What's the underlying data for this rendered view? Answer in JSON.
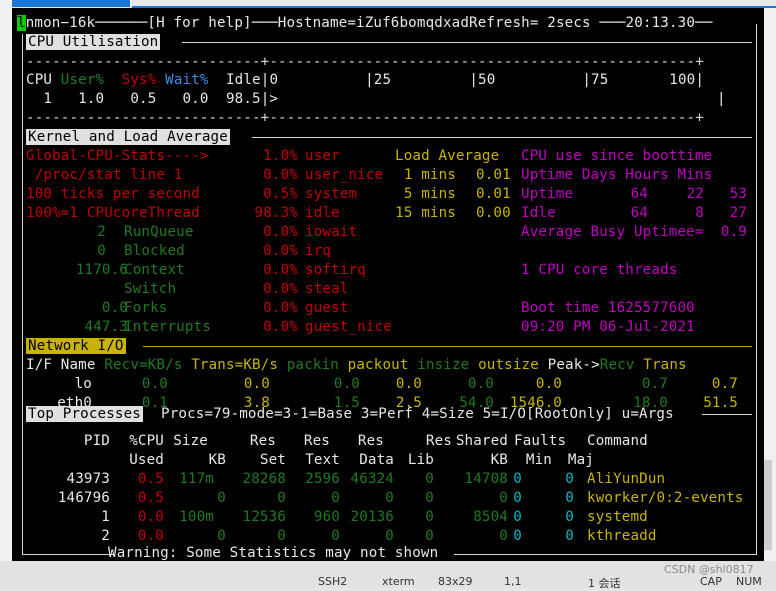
{
  "window": {
    "status_bar": {
      "ssh": "SSH2",
      "term": "xterm",
      "size": "83x29",
      "pos": "1,1",
      "sessions": "1 会话",
      "caps": "CAP",
      "num": "NUM"
    },
    "watermark": "CSDN @shl0817"
  },
  "header": {
    "cursor_char": "l",
    "app": "nmon−16k",
    "help": "[H for help]",
    "hostname_label": "Hostname=",
    "hostname": "iZuf6bomqdxad",
    "refresh_label": "Refresh=",
    "refresh": " 2secs",
    "time": "20:13.30"
  },
  "cpu_util": {
    "title": "CPU Utilisation",
    "dash_top": "---------------------------+-------------------------------------------------+",
    "col_cpu": "CPU",
    "col_user": "User%",
    "col_sys": "Sys%",
    "col_wait": "Wait%",
    "col_idle": "Idle",
    "scale": "|0          |25         |50          |75       100|",
    "row": {
      "cpu": "1",
      "user": "1.0",
      "sys": "0.5",
      "wait": "0.0",
      "idle": "98.5",
      "bar": "|>"
    },
    "bar_end": "|",
    "dash_bottom": "---------------------------+-------------------------------------------------+"
  },
  "kernel": {
    "title": "Kernel and Load Average",
    "left_labels": [
      "Global-CPU-Stats---->",
      " /proc/stat line 1",
      "100 ticks per second",
      "100%=1 CPUcoreThread"
    ],
    "counters": [
      {
        "value": "2",
        "label": "RunQueue"
      },
      {
        "value": "0",
        "label": "Blocked"
      },
      {
        "value": "1170.6",
        "label": "Context"
      },
      {
        "value": "",
        "label": "Switch"
      },
      {
        "value": "0.0",
        "label": "Forks"
      },
      {
        "value": "447.3",
        "label": "Interrupts"
      }
    ],
    "cpu_stats": [
      {
        "pct": "1.0%",
        "name": "user"
      },
      {
        "pct": "0.0%",
        "name": "user_nice"
      },
      {
        "pct": "0.5%",
        "name": "system"
      },
      {
        "pct": "98.3%",
        "name": "idle"
      },
      {
        "pct": "0.0%",
        "name": "iowait"
      },
      {
        "pct": "0.0%",
        "name": "irq"
      },
      {
        "pct": "0.0%",
        "name": "softirq"
      },
      {
        "pct": "0.0%",
        "name": "steal"
      },
      {
        "pct": "0.0%",
        "name": "guest"
      },
      {
        "pct": "0.0%",
        "name": "guest_nice"
      }
    ],
    "load_title": "Load Average",
    "load": [
      {
        "period": "1 mins",
        "value": "0.01"
      },
      {
        "period": "5 mins",
        "value": "0.01"
      },
      {
        "period": "15 mins",
        "value": "0.00"
      }
    ],
    "boot_title": "CPU use since boottime",
    "uptime_header": "Uptime Days Hours Mins",
    "uptime": {
      "label": "Uptime",
      "days": "64",
      "hours": "22",
      "mins": "53"
    },
    "idle": {
      "label": "Idle",
      "days": "64",
      "hours": "8",
      "mins": "27"
    },
    "avg_busy": "Average Busy Uptimee=  0.9",
    "cores": "1 CPU core threads",
    "boot_time": "Boot time 1625577600",
    "boot_date": "09:20 PM 06-Jul-2021"
  },
  "network": {
    "title": "Network I/O",
    "headers": {
      "ifname": "I/F Name",
      "recv": "Recv=KB/s",
      "trans": "Trans=KB/s",
      "packin": "packin",
      "packout": "packout",
      "insize": "insize",
      "outsize": "outsize",
      "peak": "Peak->",
      "peak_recv": "Recv",
      "peak_trans": "Trans"
    },
    "rows": [
      {
        "name": "lo",
        "recv": "0.0",
        "trans": "0.0",
        "packin": "0.0",
        "packout": "0.0",
        "insize": "0.0",
        "outsize": "0.0",
        "peak_recv": "0.7",
        "peak_trans": "0.7"
      },
      {
        "name": "eth0",
        "recv": "0.1",
        "trans": "3.8",
        "packin": "1.5",
        "packout": "2.5",
        "insize": "54.0",
        "outsize": "1546.0",
        "peak_recv": "18.0",
        "peak_trans": "51.5"
      }
    ]
  },
  "processes": {
    "title": "Top Processes",
    "mode_info": "Procs=79-mode=3-1=Base 3=Perf 4=Size 5=I/O[RootOnly] u=Args",
    "header1": {
      "pid": "PID",
      "cpu": "%CPU",
      "size": "Size",
      "res_set": "Res",
      "res_text": "Res",
      "res_data": "Res",
      "res_lib": "Res",
      "shared": "Shared",
      "faults": "Faults",
      "command": "Command"
    },
    "header2": {
      "cpu": "Used",
      "size": "KB",
      "res_set": "Set",
      "res_text": "Text",
      "res_data": "Data",
      "res_lib": "Lib",
      "shared": "KB",
      "min": "Min",
      "maj": "Maj"
    },
    "rows": [
      {
        "pid": "43973",
        "cpu": "0.5",
        "size": "117m",
        "res_set": "28268",
        "res_text": "2596",
        "res_data": "46324",
        "res_lib": "0",
        "shared": "14708",
        "min": "0",
        "maj": "0",
        "command": "AliYunDun"
      },
      {
        "pid": "146796",
        "cpu": "0.5",
        "size": "0",
        "res_set": "0",
        "res_text": "0",
        "res_data": "0",
        "res_lib": "0",
        "shared": "0",
        "min": "0",
        "maj": "0",
        "command": "kworker/0:2-events"
      },
      {
        "pid": "1",
        "cpu": "0.0",
        "size": "100m",
        "res_set": "12536",
        "res_text": "960",
        "res_data": "20136",
        "res_lib": "0",
        "shared": "8504",
        "min": "0",
        "maj": "0",
        "command": "systemd"
      },
      {
        "pid": "2",
        "cpu": "0.0",
        "size": "0",
        "res_set": "0",
        "res_text": "0",
        "res_data": "0",
        "res_lib": "0",
        "shared": "0",
        "min": "0",
        "maj": "0",
        "command": "kthreadd"
      }
    ],
    "warning": "Warning: Some Statistics may not shown"
  }
}
